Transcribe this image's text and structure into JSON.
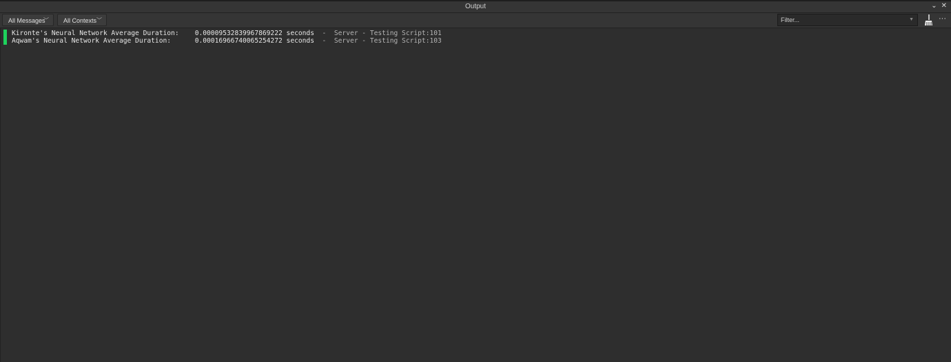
{
  "window": {
    "title": "Output"
  },
  "toolbar": {
    "messages_filter": "All Messages",
    "contexts_filter": "All Contexts",
    "filter_placeholder": "Filter..."
  },
  "colors": {
    "info_marker": "#1ed25c",
    "background": "#2e2e2e"
  },
  "messages": [
    {
      "text": "Kironte's Neural Network Average Duration:    0.00009532839967869222 seconds",
      "source": "  -  Server - Testing Script:101"
    },
    {
      "text": "Aqwam's Neural Network Average Duration:      0.00016966740065254272 seconds",
      "source": "  -  Server - Testing Script:103"
    }
  ]
}
